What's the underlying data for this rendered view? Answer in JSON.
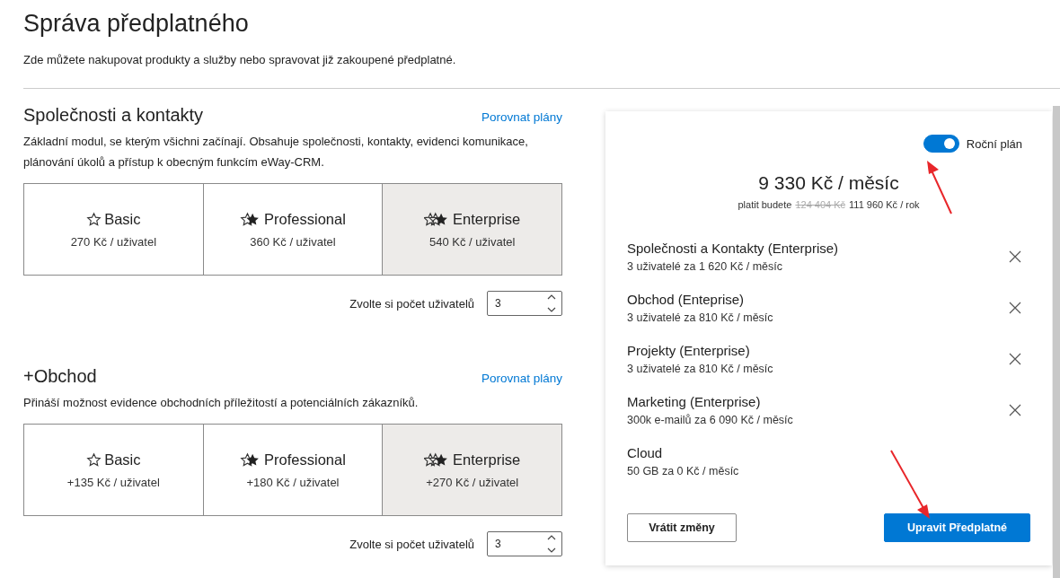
{
  "page": {
    "title": "Správa předplatného",
    "subtitle": "Zde můžete nakupovat produkty a služby nebo spravovat již zakoupené předplatné."
  },
  "modules": [
    {
      "title": "Společnosti a kontakty",
      "compare_link": "Porovnat plány",
      "description": "Základní modul, se kterým všichni začínají. Obsahuje společnosti, kontakty, evidenci komunikace, plánování úkolů a přístup k obecným funkcím eWay-CRM.",
      "plans": [
        {
          "kind": "basic",
          "name": "Basic",
          "price": "270 Kč / uživatel",
          "selected": false
        },
        {
          "kind": "professional",
          "name": "Professional",
          "price": "360 Kč / uživatel",
          "selected": false
        },
        {
          "kind": "enterprise",
          "name": "Enterprise",
          "price": "540 Kč / uživatel",
          "selected": true
        }
      ],
      "users_label": "Zvolte si počet uživatelů",
      "users": "3"
    },
    {
      "title": "+Obchod",
      "compare_link": "Porovnat plány",
      "description": "Přináší možnost evidence obchodních příležitostí a potenciálních zákazníků.",
      "plans": [
        {
          "kind": "basic",
          "name": "Basic",
          "price": "+135 Kč / uživatel",
          "selected": false
        },
        {
          "kind": "professional",
          "name": "Professional",
          "price": "+180 Kč / uživatel",
          "selected": false
        },
        {
          "kind": "enterprise",
          "name": "Enterprise",
          "price": "+270 Kč / uživatel",
          "selected": true
        }
      ],
      "users_label": "Zvolte si počet uživatelů",
      "users": "3"
    }
  ],
  "summary": {
    "annual_toggle": {
      "label": "Roční plán",
      "on": true
    },
    "monthly_total": "9 330 Kč / měsíc",
    "pay_prefix": "platit budete",
    "old_price": "124 404 Kč",
    "yearly_total": "111 960 Kč / rok",
    "items": [
      {
        "name": "Společnosti a Kontakty (Enterprise)",
        "detail": "3 uživatelé za 1 620 Kč / měsíc",
        "removable": true
      },
      {
        "name": "Obchod (Enteprise)",
        "detail": "3 uživatelé za 810 Kč / měsíc",
        "removable": true
      },
      {
        "name": "Projekty (Enterprise)",
        "detail": "3 uživatelé za 810 Kč / měsíc",
        "removable": true
      },
      {
        "name": "Marketing (Enterprise)",
        "detail": "300k e-mailů za 6 090 Kč / měsíc",
        "removable": true
      },
      {
        "name": "Cloud",
        "detail": "50 GB za 0 Kč / měsíc",
        "removable": false
      }
    ],
    "buttons": {
      "revert": "Vrátit změny",
      "update": "Upravit Předplatné"
    }
  }
}
